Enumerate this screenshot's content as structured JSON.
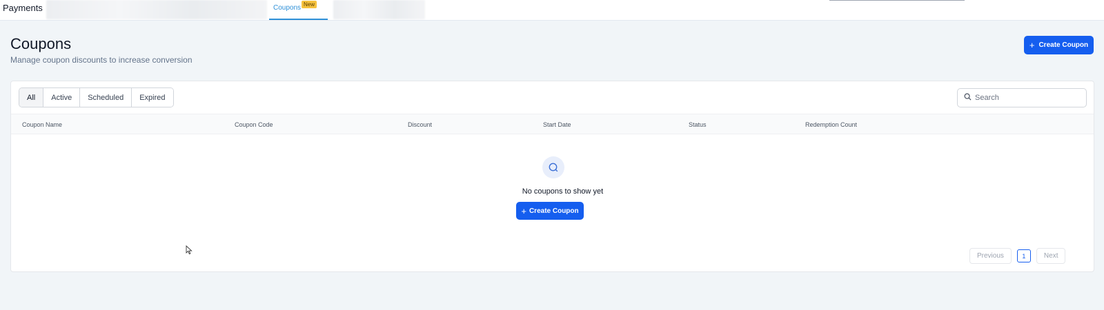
{
  "topnav": {
    "app_title": "Payments",
    "tab_coupons": {
      "label": "Coupons",
      "badge": "New"
    }
  },
  "header": {
    "title": "Coupons",
    "subtitle": "Manage coupon discounts to increase conversion",
    "create_button": {
      "label": "Create Coupon",
      "icon": "plus-icon"
    }
  },
  "filters": {
    "tabs": [
      "All",
      "Active",
      "Scheduled",
      "Expired"
    ],
    "selected": "All"
  },
  "search": {
    "placeholder": "Search",
    "icon": "search-icon"
  },
  "table": {
    "columns": [
      "Coupon Name",
      "Coupon Code",
      "Discount",
      "Start Date",
      "Status",
      "Redemption Count"
    ],
    "rows": []
  },
  "empty_state": {
    "icon": "search-icon",
    "message": "No coupons to show yet",
    "button_label": "Create Coupon"
  },
  "pagination": {
    "previous": "Previous",
    "current_page": "1",
    "next": "Next"
  },
  "colors": {
    "primary": "#155eef",
    "tab_accent": "#2e90d8",
    "badge": "#f6c23e",
    "background": "#f1f5f8"
  }
}
